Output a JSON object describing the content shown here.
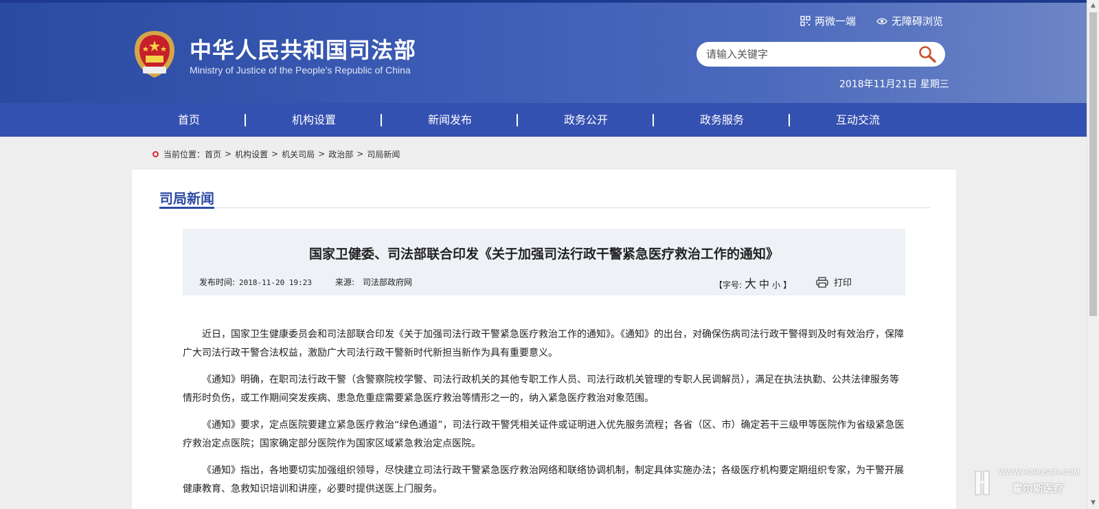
{
  "header": {
    "site_name_cn": "中华人民共和国司法部",
    "site_name_en": "Ministry of Justice of the People's Republic of China",
    "links": {
      "mobile": "两微一端",
      "accessibility": "无障碍浏览"
    },
    "search": {
      "placeholder": "请输入关键字"
    },
    "date": "2018年11月21日 星期三"
  },
  "nav": {
    "items": [
      {
        "label": "首页"
      },
      {
        "label": "机构设置"
      },
      {
        "label": "新闻发布"
      },
      {
        "label": "政务公开"
      },
      {
        "label": "政务服务"
      },
      {
        "label": "互动交流"
      }
    ]
  },
  "breadcrumb": {
    "prefix": "当前位置：",
    "items": [
      "首页",
      "机构设置",
      "机关司局",
      "政治部",
      "司局新闻"
    ],
    "separator": ">"
  },
  "section": {
    "title": "司局新闻"
  },
  "article": {
    "title": "国家卫健委、司法部联合印发《关于加强司法行政干警紧急医疗救治工作的通知》",
    "publish_label": "发布时间:",
    "publish_time": "2018-11-20 19:23",
    "source_label": "来源:",
    "source": "司法部政府网",
    "font_size": {
      "open": "【字号:",
      "large": "大",
      "medium": "中",
      "small": "小",
      "close": "】"
    },
    "print_label": "打印",
    "paragraphs": [
      "近日，国家卫生健康委员会和司法部联合印发《关于加强司法行政干警紧急医疗救治工作的通知》。《通知》的出台，对确保伤病司法行政干警得到及时有效治疗，保障广大司法行政干警合法权益，激励广大司法行政干警新时代新担当新作为具有重要意义。",
      "《通知》明确，在职司法行政干警（含警察院校学警、司法行政机关的其他专职工作人员、司法行政机关管理的专职人民调解员），满足在执法执勤、公共法律服务等情形时负伤，或工作期间突发疾病、患急危重症需要紧急医疗救治等情形之一的，纳入紧急医疗救治对象范围。",
      "《通知》要求，定点医院要建立紧急医疗救治“绿色通道”，司法行政干警凭相关证件或证明进入优先服务流程；各省（区、市）确定若干三级甲等医院作为省级紧急医疗救治定点医院；国家确定部分医院作为国家区域紧急救治定点医院。",
      "《通知》指出，各地要切实加强组织领导，尽快建立司法行政干警紧急医疗救治网络和联络协调机制，制定具体实施办法；各级医疗机构要定期组织专家，为干警开展健康教育、急救知识培训和讲座，必要时提供送医上门服务。"
    ]
  },
  "watermark": {
    "url": "WWW.HORUSCH.COM",
    "name": "霍尔斯医疗"
  },
  "colors": {
    "header_blue": "#3450b0",
    "accent_blue": "#2d4ba5",
    "breadcrumb_dot": "#d9262c"
  }
}
